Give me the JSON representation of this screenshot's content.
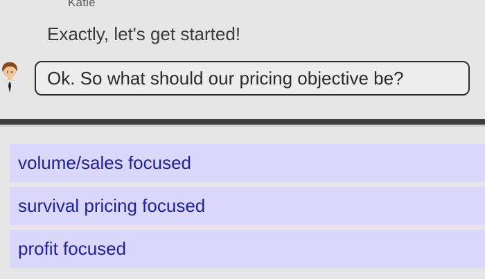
{
  "conversation": {
    "speaker_name": "Katie",
    "incoming_message": "Exactly, let's get started!",
    "player_message": "Ok. So what should our pricing objective be?"
  },
  "choices": [
    {
      "label": "volume/sales focused"
    },
    {
      "label": "survival pricing focused"
    },
    {
      "label": "profit focused"
    }
  ],
  "colors": {
    "background": "#e6e6e6",
    "choice_background": "#d9d8fb",
    "choice_text": "#22209a",
    "divider": "#3d3d3d"
  },
  "icons": {
    "player_avatar": "person-avatar-icon"
  }
}
